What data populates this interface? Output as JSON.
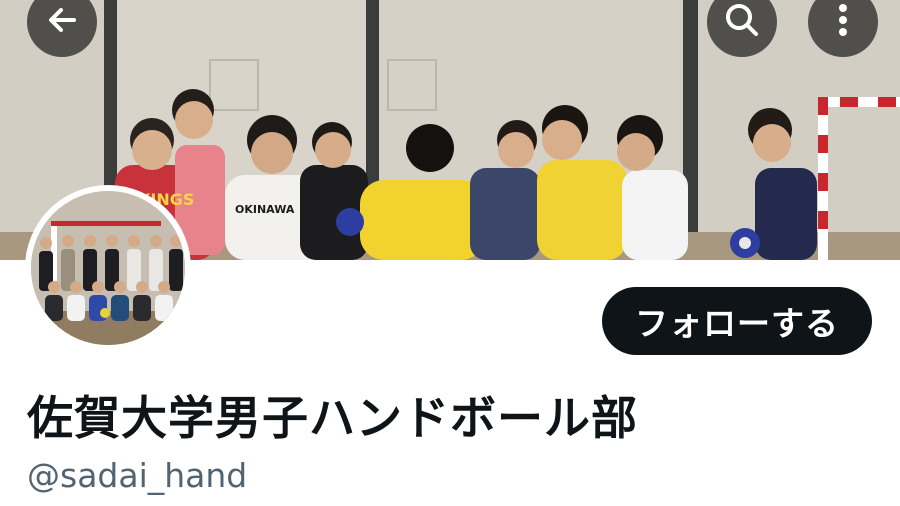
{
  "profile": {
    "display_name": "佐賀大学男子ハンドボール部",
    "handle": "@sadai_hand",
    "follow_label": "フォローする"
  },
  "banner": {
    "shirt_texts": [
      "KINGS",
      "OKINAWA"
    ]
  },
  "toolbar": {
    "back_icon": "arrow-left-icon",
    "search_icon": "search-icon",
    "more_icon": "more-vertical-icon"
  },
  "colors": {
    "follow_bg": "#0f1419",
    "follow_text": "#ffffff",
    "name_text": "#0f1419",
    "handle_text": "#536471",
    "overlay_btn": "#1e1e1e"
  }
}
